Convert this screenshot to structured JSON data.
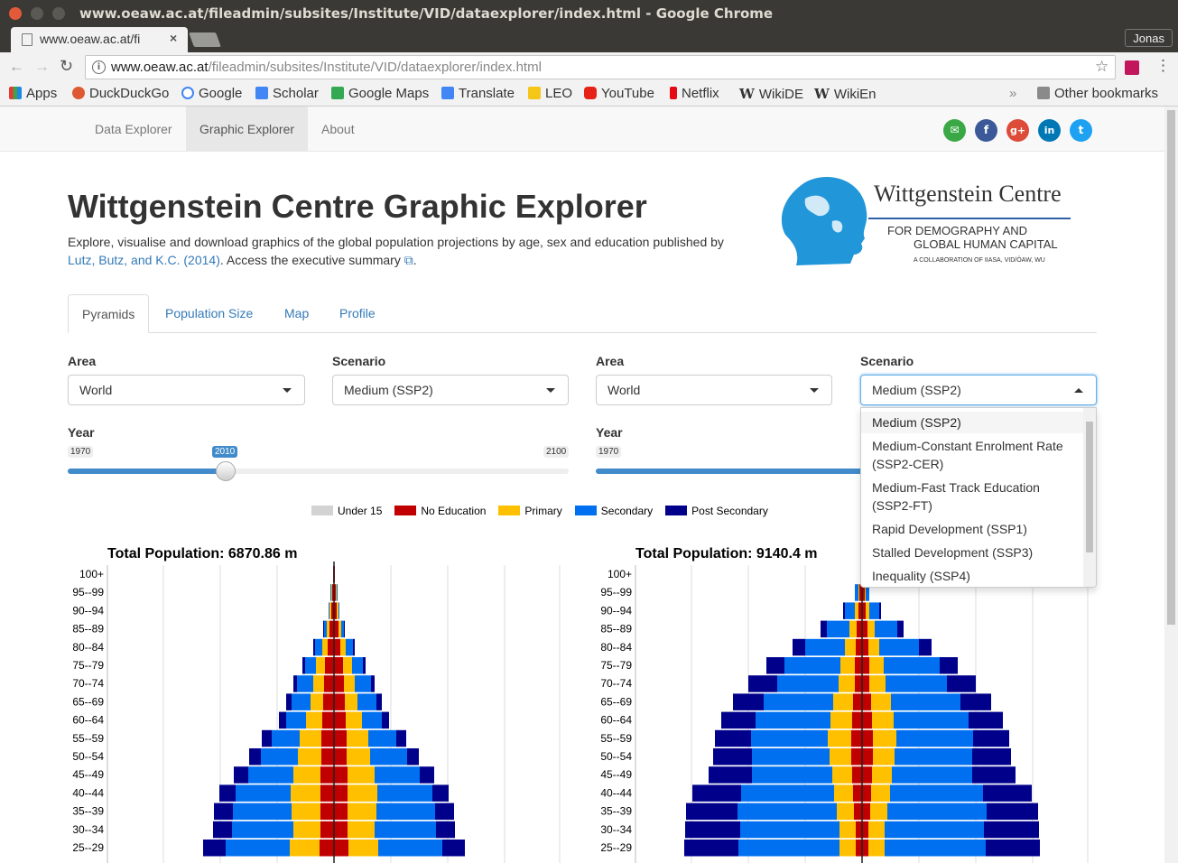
{
  "browser": {
    "window_title": "www.oeaw.ac.at/fileadmin/subsites/Institute/VID/dataexplorer/index.html - Google Chrome",
    "tab_title": "www.oeaw.ac.at/fi",
    "profile": "Jonas",
    "url_host": "www.oeaw.ac.at",
    "url_path": "/fileadmin/subsites/Institute/VID/dataexplorer/index.html",
    "bookmarks": [
      "Apps",
      "DuckDuckGo",
      "Google",
      "Scholar",
      "Google Maps",
      "Translate",
      "LEO",
      "YouTube",
      "Netflix",
      "WikiDE",
      "WikiEn"
    ],
    "other_bookmarks": "Other bookmarks",
    "more": "»"
  },
  "nav": {
    "items": [
      "Data Explorer",
      "Graphic Explorer",
      "About"
    ],
    "active": "Graphic Explorer"
  },
  "header": {
    "title": "Wittgenstein Centre Graphic Explorer",
    "intro_1": "Explore, visualise and download graphics of the global population projections by age, sex and education published by",
    "intro_link": "Lutz, Butz, and K.C. (2014)",
    "intro_2": ". Access the executive summary",
    "intro_end": ".",
    "logo_name": "Wittgenstein Centre",
    "logo_sub1": "FOR DEMOGRAPHY AND",
    "logo_sub2": "GLOBAL HUMAN CAPITAL",
    "logo_sub3": "A COLLABORATION OF IIASA, VID/ÖAW, WU"
  },
  "tabs": [
    "Pyramids",
    "Population Size",
    "Map",
    "Profile"
  ],
  "left": {
    "area_label": "Area",
    "area": "World",
    "scenario_label": "Scenario",
    "scenario": "Medium (SSP2)",
    "year_label": "Year",
    "year_min": "1970",
    "year_max": "2100",
    "year": "2010"
  },
  "right": {
    "area_label": "Area",
    "area": "World",
    "scenario_label": "Scenario",
    "scenario": "Medium (SSP2)",
    "year_label": "Year",
    "year_min": "1970"
  },
  "dropdown_options": [
    "Medium (SSP2)",
    "Medium-Constant Enrolment Rate (SSP2-CER)",
    "Medium-Fast Track Education (SSP2-FT)",
    "Rapid Development (SSP1)",
    "Stalled Development (SSP3)",
    "Inequality (SSP4)"
  ],
  "legend": [
    {
      "label": "Under 15",
      "color": "#d3d3d3"
    },
    {
      "label": "No Education",
      "color": "#c00000"
    },
    {
      "label": "Primary",
      "color": "#ffc000"
    },
    {
      "label": "Secondary",
      "color": "#0070f0"
    },
    {
      "label": "Post Secondary",
      "color": "#00008b"
    }
  ],
  "chart_data": [
    {
      "type": "bar",
      "title": "Total Population: 6870.86 m",
      "categories": [
        "100+",
        "95--99",
        "90--94",
        "85--89",
        "80--84",
        "75--79",
        "70--74",
        "65--69",
        "60--64",
        "55--59",
        "50--54",
        "45--49",
        "40--44",
        "35--39",
        "30--34",
        "25--29"
      ],
      "series": [
        {
          "name": "No Education",
          "values": [
            1,
            2,
            3,
            5,
            7,
            10,
            11,
            12,
            13,
            14,
            14,
            15,
            15,
            15,
            15,
            16
          ]
        },
        {
          "name": "Primary",
          "values": [
            0,
            1,
            2,
            3,
            6,
            10,
            12,
            14,
            18,
            24,
            26,
            30,
            33,
            32,
            30,
            33
          ]
        },
        {
          "name": "Secondary",
          "values": [
            0,
            1,
            1,
            3,
            8,
            12,
            18,
            21,
            22,
            31,
            41,
            50,
            61,
            65,
            68,
            71
          ]
        },
        {
          "name": "Post Secondary",
          "values": [
            0,
            0,
            0,
            1,
            2,
            3,
            4,
            6,
            8,
            11,
            13,
            16,
            18,
            21,
            21,
            25
          ]
        }
      ]
    },
    {
      "type": "bar",
      "title": "Total Population: 9140.4 m",
      "categories": [
        "100+",
        "95--99",
        "90--94",
        "85--89",
        "80--84",
        "75--79",
        "70--74",
        "65--69",
        "60--64",
        "55--59",
        "50--54",
        "45--49",
        "40--44",
        "35--39",
        "30--34",
        "25--29"
      ],
      "series": [
        {
          "name": "No Education",
          "values": [
            1,
            3,
            4,
            6,
            7,
            8,
            8,
            10,
            11,
            12,
            12,
            11,
            10,
            9,
            7,
            7
          ]
        },
        {
          "name": "Primary",
          "values": [
            0,
            1,
            4,
            8,
            12,
            16,
            18,
            22,
            24,
            26,
            24,
            22,
            21,
            19,
            18,
            18
          ]
        },
        {
          "name": "Secondary",
          "values": [
            0,
            4,
            11,
            25,
            44,
            62,
            68,
            77,
            83,
            85,
            86,
            89,
            103,
            110,
            110,
            112
          ]
        },
        {
          "name": "Post Secondary",
          "values": [
            0,
            0,
            2,
            7,
            14,
            20,
            32,
            34,
            38,
            40,
            43,
            48,
            54,
            57,
            61,
            60
          ]
        }
      ]
    }
  ]
}
